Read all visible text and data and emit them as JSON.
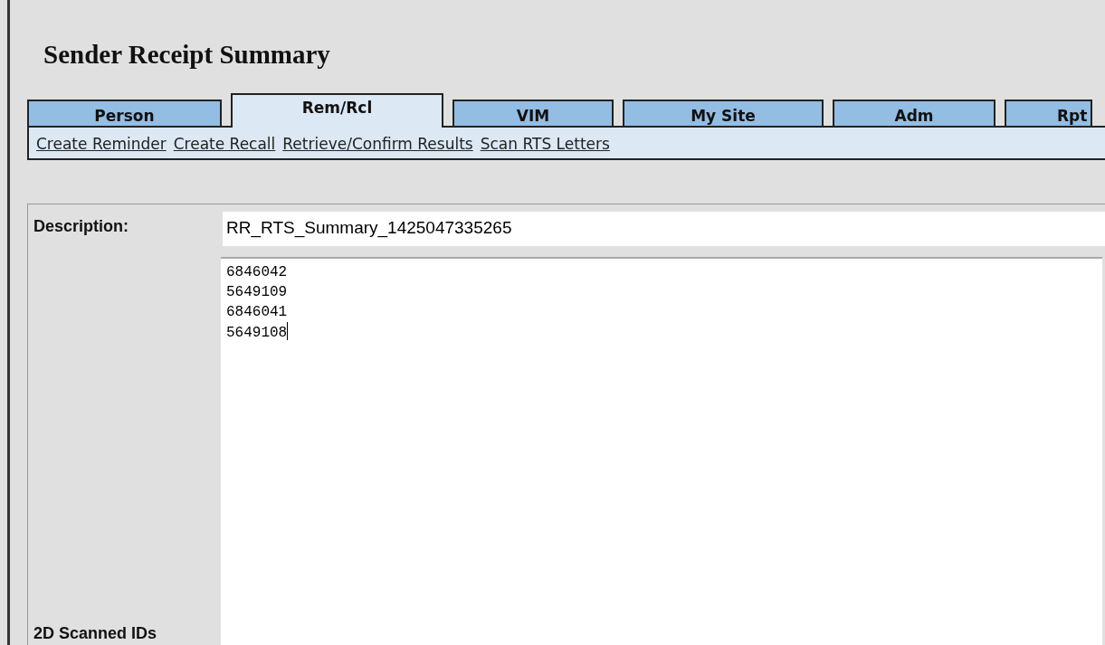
{
  "page": {
    "title": "Sender Receipt Summary"
  },
  "tabs": [
    {
      "label": "Person",
      "selected": false
    },
    {
      "label": "Rem/Rcl",
      "selected": true
    },
    {
      "label": "VIM",
      "selected": false
    },
    {
      "label": "My Site",
      "selected": false
    },
    {
      "label": "Adm",
      "selected": false
    },
    {
      "label": "Rpt",
      "selected": false
    }
  ],
  "subnav": [
    "Create Reminder",
    "Create Recall",
    "Retrieve/Confirm Results",
    "Scan RTS Letters"
  ],
  "form": {
    "description_label": "Description:",
    "description_value": "RR_RTS_Summary_1425047335265",
    "ids_label": "2D Scanned IDs",
    "ids": [
      "6846042",
      "5649109",
      "6846041",
      "5649108"
    ]
  }
}
